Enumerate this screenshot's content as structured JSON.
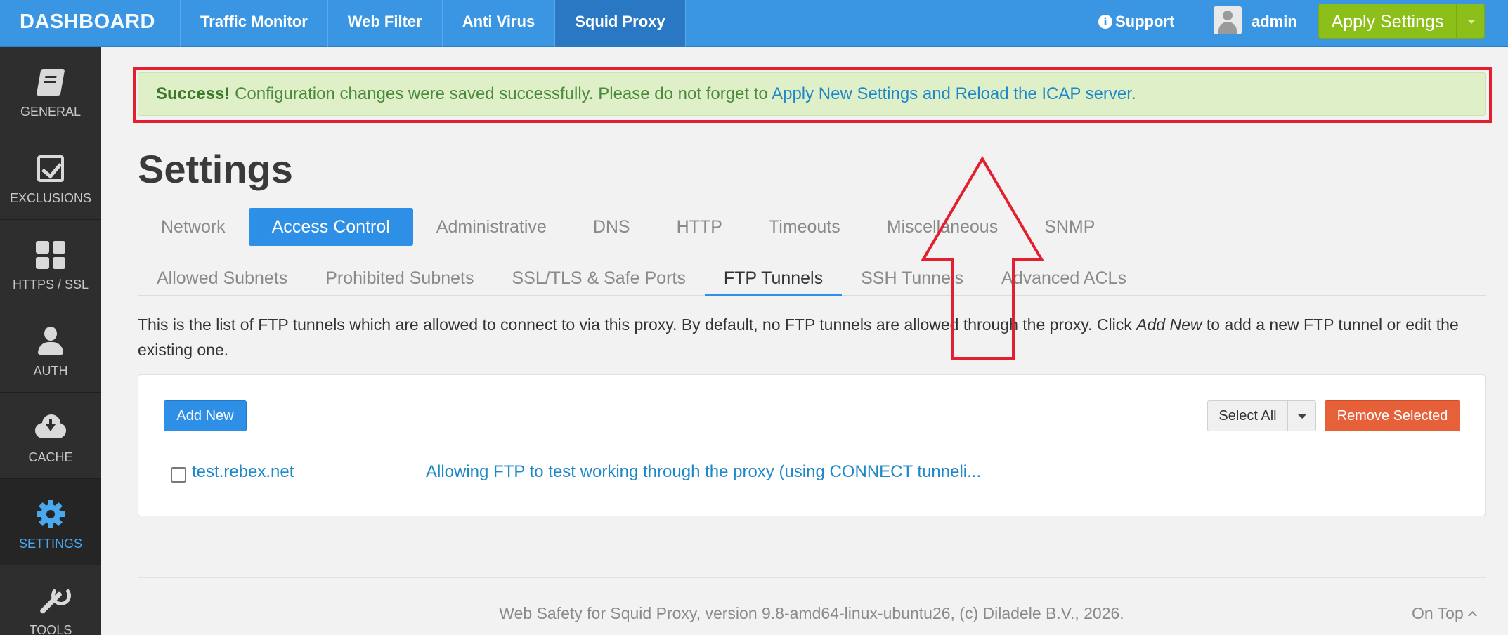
{
  "topbar": {
    "brand": "DASHBOARD",
    "tabs": [
      {
        "label": "Traffic Monitor"
      },
      {
        "label": "Web Filter"
      },
      {
        "label": "Anti Virus"
      },
      {
        "label": "Squid Proxy"
      }
    ],
    "support_label": "Support",
    "user_label": "admin",
    "apply_label": "Apply Settings",
    "accent_color": "#3a95e3",
    "apply_color": "#8cbf1a"
  },
  "sidebar": {
    "items": [
      {
        "label": "GENERAL",
        "icon": "book-icon"
      },
      {
        "label": "EXCLUSIONS",
        "icon": "checkbox-icon"
      },
      {
        "label": "HTTPS / SSL",
        "icon": "grid-icon"
      },
      {
        "label": "AUTH",
        "icon": "user-icon"
      },
      {
        "label": "CACHE",
        "icon": "cloud-download-icon"
      },
      {
        "label": "SETTINGS",
        "icon": "gear-icon",
        "active": true
      },
      {
        "label": "TOOLS",
        "icon": "wrench-icon"
      }
    ]
  },
  "alert": {
    "strong": "Success!",
    "text": "Configuration changes were saved successfully. Please do not forget to",
    "link": "Apply New Settings and Reload the ICAP server",
    "end": "."
  },
  "page": {
    "title": "Settings",
    "tabs": [
      {
        "label": "Network"
      },
      {
        "label": "Access Control",
        "active": true
      },
      {
        "label": "Administrative"
      },
      {
        "label": "DNS"
      },
      {
        "label": "HTTP"
      },
      {
        "label": "Timeouts"
      },
      {
        "label": "Miscellaneous"
      },
      {
        "label": "SNMP"
      }
    ],
    "subtabs": [
      {
        "label": "Allowed Subnets"
      },
      {
        "label": "Prohibited Subnets"
      },
      {
        "label": "SSL/TLS & Safe Ports"
      },
      {
        "label": "FTP Tunnels",
        "active": true
      },
      {
        "label": "SSH Tunnels"
      },
      {
        "label": "Advanced ACLs"
      }
    ],
    "description_before": "This is the list of FTP tunnels which are allowed to connect to via this proxy. By default, no FTP tunnels are allowed through the proxy. Click",
    "description_em": "Add New",
    "description_after": "to add a new FTP tunnel or edit the existing one."
  },
  "panel": {
    "add_label": "Add New",
    "select_all_label": "Select All",
    "remove_label": "Remove Selected",
    "rows": [
      {
        "host": "test.rebex.net",
        "comment": "Allowing FTP to test working through the proxy (using CONNECT tunneli..."
      }
    ]
  },
  "footer": {
    "text": "Web Safety for Squid Proxy, version 9.8-amd64-linux-ubuntu26, (c) Diladele B.V., 2026.",
    "on_top": "On Top"
  },
  "annotation": {
    "highlight_color": "#e3202f"
  }
}
